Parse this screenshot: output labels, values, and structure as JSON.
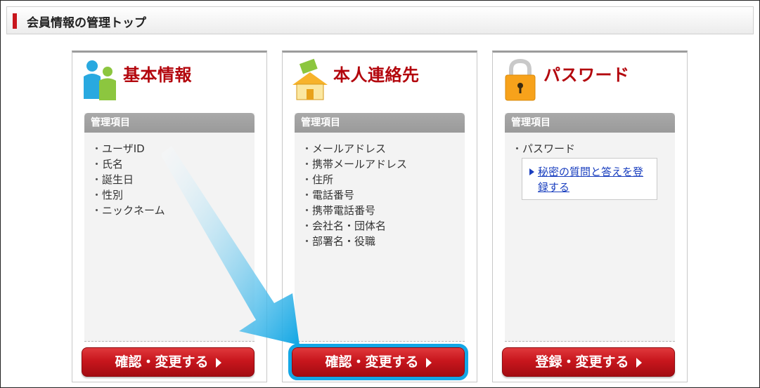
{
  "header": {
    "title": "会員情報の管理トップ"
  },
  "cards": [
    {
      "title": "基本情報",
      "icon": "users-icon",
      "section_label": "管理項目",
      "items": [
        "ユーザID",
        "氏名",
        "誕生日",
        "性別",
        "ニックネーム"
      ],
      "button_label": "確認・変更する"
    },
    {
      "title": "本人連絡先",
      "icon": "house-mail-icon",
      "section_label": "管理項目",
      "items": [
        "メールアドレス",
        "携帯メールアドレス",
        "住所",
        "電話番号",
        "携帯電話番号",
        "会社名・団体名",
        "部署名・役職"
      ],
      "button_label": "確認・変更する"
    },
    {
      "title": "パスワード",
      "icon": "padlock-icon",
      "section_label": "管理項目",
      "items": [
        "パスワード"
      ],
      "sublink": "秘密の質問と答えを登録する",
      "button_label": "登録・変更する"
    }
  ],
  "colors": {
    "accent": "#c8161d",
    "title": "#b3060d",
    "highlight": "#13a7e6",
    "link": "#1a3fbf"
  }
}
